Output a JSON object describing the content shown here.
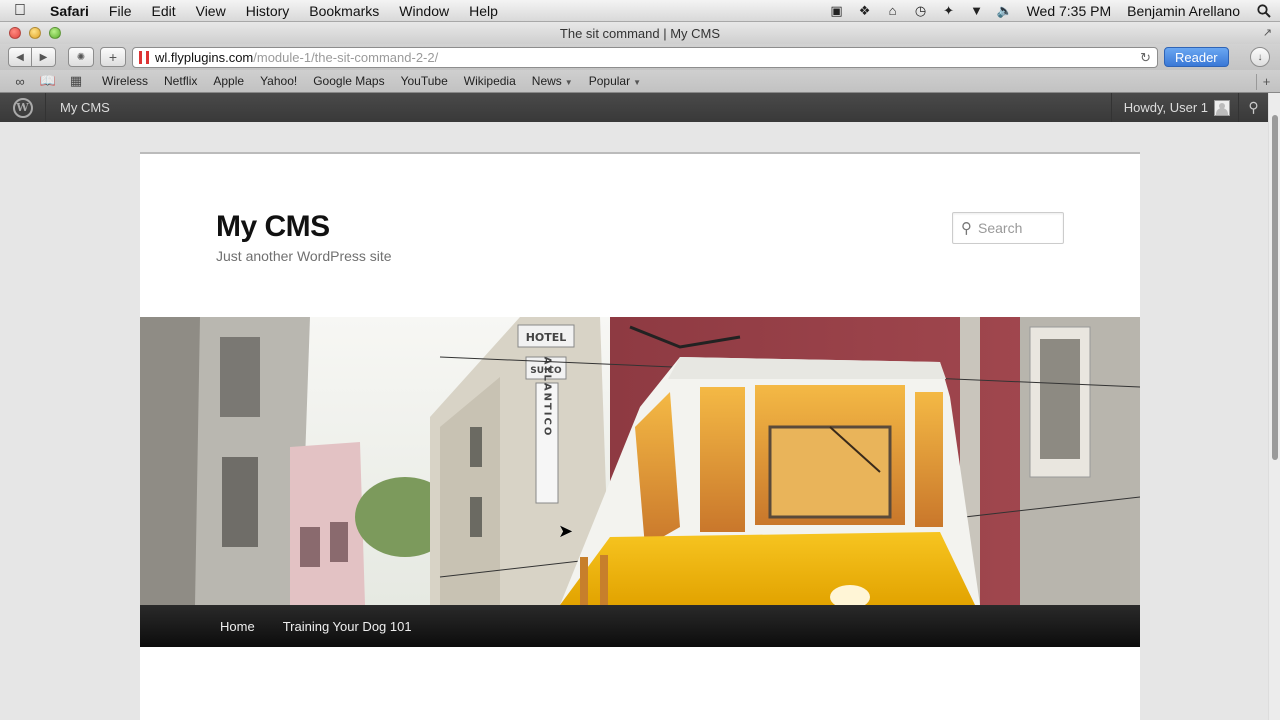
{
  "menubar": {
    "app": "Safari",
    "items": [
      "File",
      "Edit",
      "View",
      "History",
      "Bookmarks",
      "Window",
      "Help"
    ],
    "clock": "Wed 7:35 PM",
    "user": "Benjamin Arellano"
  },
  "window": {
    "title": "The sit command | My CMS"
  },
  "toolbar": {
    "url_host": "wl.flyplugins.com",
    "url_path": "/module-1/the-sit-command-2-2/",
    "reader_label": "Reader"
  },
  "bookmarks": {
    "items": [
      "Wireless",
      "Netflix",
      "Apple",
      "Yahoo!",
      "Google Maps",
      "YouTube",
      "Wikipedia"
    ],
    "folders": [
      "News",
      "Popular"
    ]
  },
  "adminbar": {
    "site_name": "My CMS",
    "howdy": "Howdy, User 1"
  },
  "site": {
    "title": "My CMS",
    "description": "Just another WordPress site",
    "search_placeholder": "Search",
    "header_sign_letters": [
      "HOTEL",
      "SUICO",
      "ATLANTICO"
    ],
    "nav": [
      "Home",
      "Training Your Dog 101"
    ]
  },
  "colors": {
    "admin_bar": "#464646",
    "nav_bar": "#111111",
    "reader_button": "#3a78d6",
    "tram_yellow": "#f1b400"
  }
}
